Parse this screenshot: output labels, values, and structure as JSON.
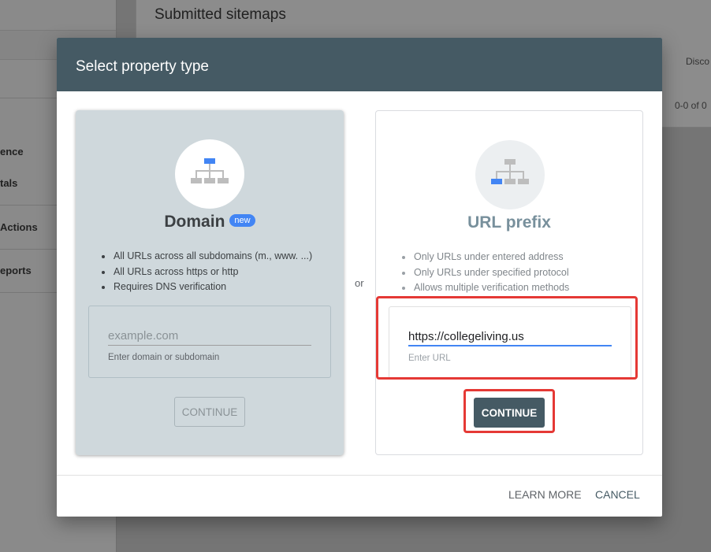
{
  "background": {
    "page_title": "Submitted sitemaps",
    "sidebar_labels": [
      "ence",
      "tals",
      "Actions",
      "eports"
    ],
    "column_header": "Disco",
    "range_text": "0-0 of 0"
  },
  "dialog": {
    "title": "Select property type",
    "or_label": "or",
    "domain_card": {
      "title": "Domain",
      "badge": "new",
      "bullets": [
        "All URLs across all subdomains (m., www. ...)",
        "All URLs across https or http",
        "Requires DNS verification"
      ],
      "input_placeholder": "example.com",
      "input_value": "",
      "helper": "Enter domain or subdomain",
      "button": "CONTINUE"
    },
    "url_card": {
      "title": "URL prefix",
      "bullets": [
        "Only URLs under entered address",
        "Only URLs under specified protocol",
        "Allows multiple verification methods"
      ],
      "input_value": "https://collegeliving.us",
      "helper": "Enter URL",
      "button": "CONTINUE"
    },
    "footer": {
      "learn_more": "LEARN MORE",
      "cancel": "CANCEL"
    }
  },
  "colors": {
    "header": "#455a64",
    "accent_blue": "#4285f4",
    "highlight_red": "#e53935",
    "domain_card_bg": "#cfd8dc"
  },
  "icons": {
    "property_tree": "sitemap-tree-icon"
  }
}
